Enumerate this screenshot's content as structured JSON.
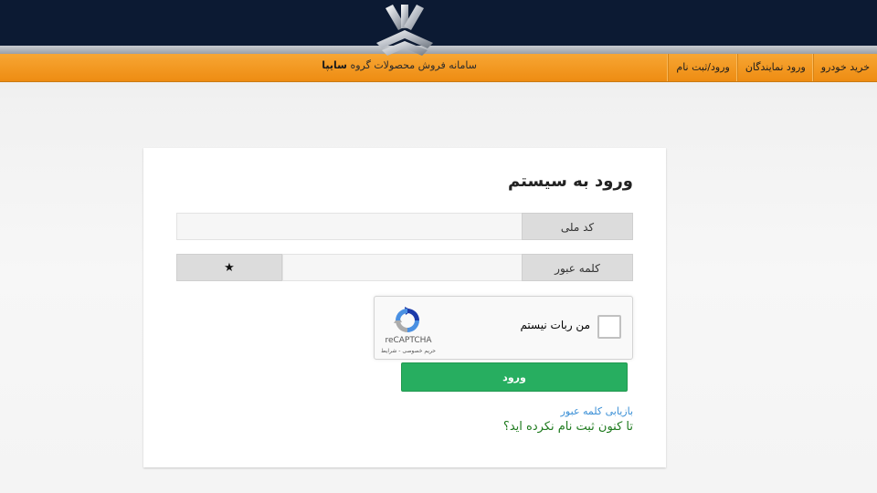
{
  "header": {
    "tagline_prefix": "سامانه فروش محصولات گروه",
    "tagline_brand": "سایپا",
    "nav": [
      {
        "label": "خرید خودرو"
      },
      {
        "label": "ورود نمایندگان"
      },
      {
        "label": "ورود/ثبت نام"
      }
    ]
  },
  "login": {
    "title": "ورود به سیستم",
    "national_code_label": "کد ملی",
    "national_code_value": "",
    "password_label": "کلمه عبور",
    "password_value": "",
    "password_toggle": "★",
    "submit_label": "ورود",
    "forgot_password": "بازیابی کلمه عبور",
    "register_prompt": "تا کنون ثبت نام نکرده اید؟"
  },
  "recaptcha": {
    "label": "من ربات نیستم",
    "brand": "reCAPTCHA",
    "terms": "حریم خصوصی - شرایط"
  },
  "colors": {
    "header_navy": "#0c1a33",
    "header_orange": "#f39a1f",
    "submit_green": "#27ae60",
    "link_blue": "#3a8fd6",
    "link_green": "#1e7a1e"
  }
}
